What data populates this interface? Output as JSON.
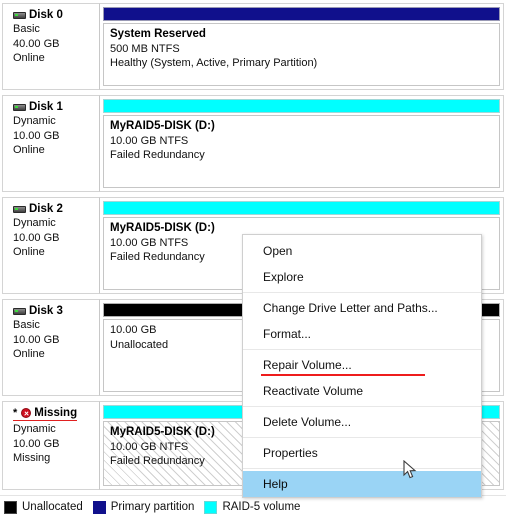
{
  "colors": {
    "primary_partition": "#10108c",
    "raid5_volume": "#00ffff",
    "unallocated": "#000000",
    "highlight": "#9ad4f5",
    "annotation_red": "#ee1c1c"
  },
  "disks": [
    {
      "id": "disk0",
      "icon": "drive-icon",
      "title": "Disk 0",
      "type": "Basic",
      "size": "40.00 GB",
      "status": "Online",
      "title_underlined": false,
      "cap_bar_color": "navy",
      "volumes": [
        {
          "name": "System Reserved",
          "size_fs": "500 MB NTFS",
          "status": "Healthy (System, Active, Primary Partition)",
          "hatched": false
        }
      ]
    },
    {
      "id": "disk1",
      "icon": "drive-icon",
      "title": "Disk 1",
      "type": "Dynamic",
      "size": "10.00 GB",
      "status": "Online",
      "title_underlined": false,
      "cap_bar_color": "cyan",
      "volumes": [
        {
          "name": "MyRAID5-DISK  (D:)",
          "size_fs": "10.00 GB NTFS",
          "status": "Failed Redundancy",
          "hatched": false
        }
      ]
    },
    {
      "id": "disk2",
      "icon": "drive-icon",
      "title": "Disk 2",
      "type": "Dynamic",
      "size": "10.00 GB",
      "status": "Online",
      "title_underlined": false,
      "cap_bar_color": "cyan",
      "volumes": [
        {
          "name": "MyRAID5-DISK  (D:)",
          "size_fs": "10.00 GB NTFS",
          "status": "Failed Redundancy",
          "hatched": false
        }
      ]
    },
    {
      "id": "disk3",
      "icon": "drive-icon",
      "title": "Disk 3",
      "type": "Basic",
      "size": "10.00 GB",
      "status": "Online",
      "title_underlined": false,
      "cap_bar_color": "black",
      "volumes": [
        {
          "name": "",
          "size_fs": "10.00 GB",
          "status": "Unallocated",
          "hatched": false
        }
      ]
    },
    {
      "id": "missing",
      "icon": "error-icon",
      "title": "Missing",
      "title_prefix": "*",
      "type": "Dynamic",
      "size": "10.00 GB",
      "status": "Missing",
      "title_underlined": true,
      "cap_bar_color": "cyan",
      "volumes": [
        {
          "name": "MyRAID5-DISK  (D:)",
          "size_fs": "10.00 GB NTFS",
          "status": "Failed Redundancy",
          "hatched": true
        }
      ]
    }
  ],
  "context_menu": {
    "items": [
      {
        "label": "Open",
        "highlighted": false,
        "annotated": false,
        "separator_after": false
      },
      {
        "label": "Explore",
        "highlighted": false,
        "annotated": false,
        "separator_after": true
      },
      {
        "label": "Change Drive Letter and Paths...",
        "highlighted": false,
        "annotated": false,
        "separator_after": false
      },
      {
        "label": "Format...",
        "highlighted": false,
        "annotated": false,
        "separator_after": true
      },
      {
        "label": "Repair Volume...",
        "highlighted": false,
        "annotated": true,
        "separator_after": false
      },
      {
        "label": "Reactivate Volume",
        "highlighted": false,
        "annotated": false,
        "separator_after": true
      },
      {
        "label": "Delete Volume...",
        "highlighted": false,
        "annotated": false,
        "separator_after": true
      },
      {
        "label": "Properties",
        "highlighted": false,
        "annotated": false,
        "separator_after": true
      },
      {
        "label": "Help",
        "highlighted": true,
        "annotated": false,
        "separator_after": false
      }
    ]
  },
  "legend": {
    "items": [
      {
        "label": "Unallocated",
        "swatch_class": "sw-unalloc",
        "icon": "unallocated-swatch"
      },
      {
        "label": "Primary partition",
        "swatch_class": "sw-primary",
        "icon": "primary-partition-swatch"
      },
      {
        "label": "RAID-5 volume",
        "swatch_class": "sw-raid5",
        "icon": "raid5-volume-swatch"
      }
    ]
  }
}
